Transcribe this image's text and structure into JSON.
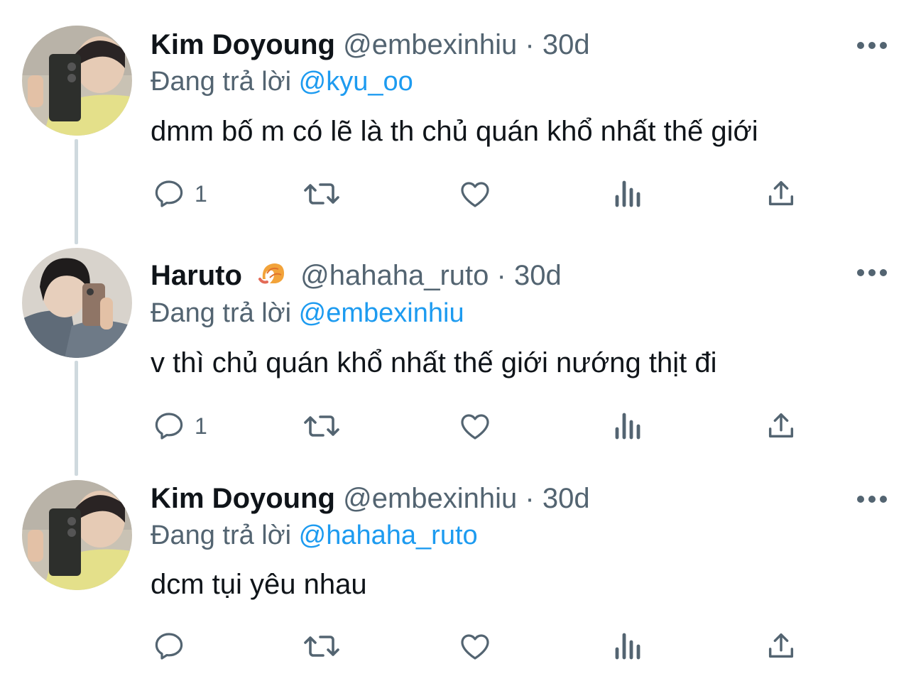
{
  "tweets": [
    {
      "name": "Kim Doyoung",
      "handle": "@embexinhiu",
      "separator": "·",
      "time": "30d",
      "reply_prefix": "Đang trả lời",
      "reply_to": "@kyu_oo",
      "text": "dmm bố m có lẽ là th chủ quán khổ nhất thế giới",
      "reply_count": "1",
      "avatar": "avatar-mirror-selfie"
    },
    {
      "name": "Haruto",
      "name_emoji": "shrimp-emoji",
      "handle": "@hahaha_ruto",
      "separator": "·",
      "time": "30d",
      "reply_prefix": "Đang trả lời",
      "reply_to": "@embexinhiu",
      "text": "v thì chủ quán khổ nhất thế giới nướng thịt đi",
      "reply_count": "1",
      "avatar": "avatar-mirror-selfie"
    },
    {
      "name": "Kim Doyoung",
      "handle": "@embexinhiu",
      "separator": "·",
      "time": "30d",
      "reply_prefix": "Đang trả lời",
      "reply_to": "@hahaha_ruto",
      "text": "dcm tụi yêu nhau",
      "reply_count": "",
      "avatar": "avatar-mirror-selfie"
    }
  ],
  "icons": [
    "more-icon",
    "reply-icon",
    "retweet-icon",
    "like-icon",
    "views-icon",
    "share-icon"
  ],
  "colors": {
    "link": "#1d9bf0",
    "secondary": "#536471",
    "thread_line": "#cfd9de",
    "text": "#0f1419"
  }
}
